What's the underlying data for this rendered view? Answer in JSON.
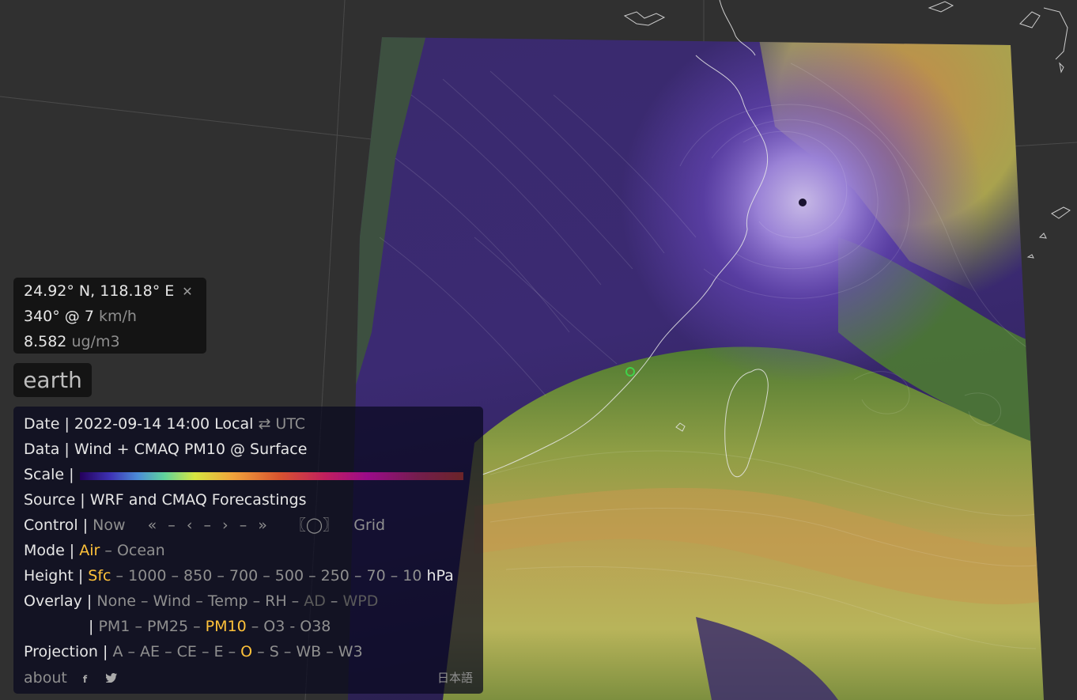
{
  "location": {
    "coords": "24.92° N, 118.18° E",
    "close_icon": "close-icon",
    "wind": "340° @ 7",
    "wind_unit": "km/h",
    "value": "8.582",
    "value_unit": "ug/m3"
  },
  "app": {
    "title": "earth"
  },
  "menu": {
    "date_label": "Date |",
    "date_value": "2022-09-14 14:00 Local",
    "date_toggle_icon": "swap-arrows-icon",
    "date_toggle": "⇄ UTC",
    "data_label": "Data |",
    "data_value": "Wind + CMAQ PM10 @ Surface",
    "scale_label": "Scale |",
    "source_label": "Source |",
    "source_value": "WRF and CMAQ Forecastings",
    "control_label": "Control |",
    "control_now": "Now",
    "control_first": "«",
    "control_prev": "‹",
    "control_next": "›",
    "control_last": "»",
    "control_sep": "–",
    "control_nav": "〖◯〗",
    "control_grid": "Grid",
    "mode_label": "Mode |",
    "mode_air": "Air",
    "mode_ocean": "Ocean",
    "height_label": "Height |",
    "heights": [
      "Sfc",
      "1000",
      "850",
      "700",
      "500",
      "250",
      "70",
      "10"
    ],
    "height_unit": "hPa",
    "overlay_label": "Overlay |",
    "overlays_row1": [
      "None",
      "Wind",
      "Temp",
      "RH",
      "AD",
      "WPD"
    ],
    "overlays_row2": [
      "PM1",
      "PM25",
      "PM10",
      "O3",
      "O38"
    ],
    "overlay_pipe": "|",
    "projection_label": "Projection |",
    "projections": [
      "A",
      "AE",
      "CE",
      "E",
      "O",
      "S",
      "WB",
      "W3"
    ],
    "about": "about",
    "facebook_icon": "facebook-icon",
    "twitter_icon": "twitter-icon",
    "language": "日本語"
  },
  "colors": {
    "highlight": "#ffc23a",
    "dim": "#8f8f8f",
    "marker": "#3fd14a"
  }
}
